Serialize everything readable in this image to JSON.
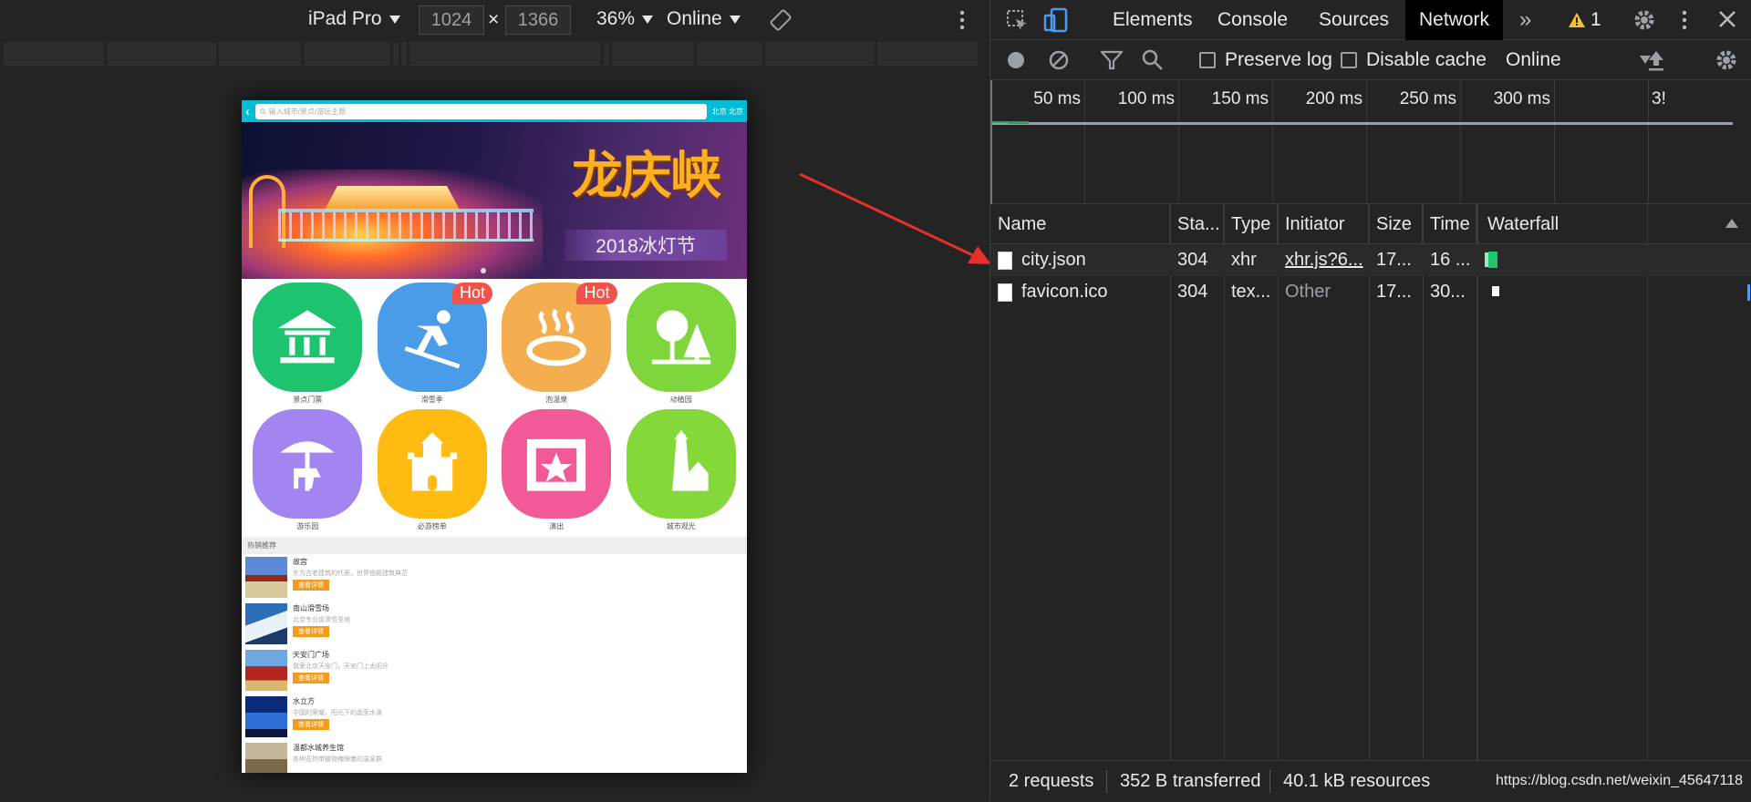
{
  "device_toolbar": {
    "device": "iPad Pro",
    "width": "1024",
    "times": "×",
    "height": "1366",
    "zoom": "36%",
    "throttle": "Online"
  },
  "mobile_page": {
    "search_placeholder": "输入城市/景点/游玩主题",
    "city": "北京 北京",
    "banner_title": "龙庆峡",
    "banner_subtitle": "2018冰灯节",
    "categories": [
      {
        "label": "景点门票",
        "icon": "pavilion-icon",
        "color": "#1ec36f",
        "hot": ""
      },
      {
        "label": "滑雪季",
        "icon": "skier-icon",
        "color": "#4a9be8",
        "hot": "Hot"
      },
      {
        "label": "泡温泉",
        "icon": "hot-spring-icon",
        "color": "#f4ad4f",
        "hot": "Hot"
      },
      {
        "label": "动植园",
        "icon": "trees-icon",
        "color": "#7fd53c",
        "hot": ""
      },
      {
        "label": "游乐园",
        "icon": "carousel-icon",
        "color": "#a285f0",
        "hot": ""
      },
      {
        "label": "必游榜单",
        "icon": "castle-icon",
        "color": "#ffbb12",
        "hot": ""
      },
      {
        "label": "演出",
        "icon": "stage-icon",
        "color": "#f25a97",
        "hot": ""
      },
      {
        "label": "城市观光",
        "icon": "tower-icon",
        "color": "#84d83a",
        "hot": ""
      }
    ],
    "recommend_title": "热销推荐",
    "recommend_items": [
      {
        "name": "故宫",
        "desc": "东方古老建筑的代表，世界宫殿建筑典范",
        "tag": "查看详情"
      },
      {
        "name": "南山滑雪场",
        "desc": "北京专业级滑雪圣地",
        "tag": "查看详情"
      },
      {
        "name": "天安门广场",
        "desc": "我爱北京天安门，天安门上太阳升",
        "tag": "查看详情"
      },
      {
        "name": "水立方",
        "desc": "中国的荣耀，阳光下的晶莹水滴",
        "tag": "查看详情"
      },
      {
        "name": "温都水城养生馆",
        "desc": "各种亚热带植物掩映着的温泉群",
        "tag": ""
      }
    ]
  },
  "devtools": {
    "tabs": [
      "Elements",
      "Console",
      "Sources",
      "Network"
    ],
    "active_tab": "Network",
    "warning_count": "1",
    "toolbar": {
      "preserve_log": "Preserve log",
      "disable_cache": "Disable cache",
      "throttle": "Online"
    },
    "timeline_ticks": [
      "50 ms",
      "100 ms",
      "150 ms",
      "200 ms",
      "250 ms",
      "300 ms",
      "3!"
    ],
    "columns": [
      "Name",
      "Sta...",
      "Type",
      "Initiator",
      "Size",
      "Time",
      "Waterfall"
    ],
    "rows": [
      {
        "name": "city.json",
        "status": "304",
        "type": "xhr",
        "initiator": "xhr.js?6...",
        "size": "17...",
        "time": "16 ..."
      },
      {
        "name": "favicon.ico",
        "status": "304",
        "type": "tex...",
        "initiator": "Other",
        "size": "17...",
        "time": "30..."
      }
    ],
    "status_bar": {
      "requests": "2 requests",
      "transferred": "352 B transferred",
      "resources": "40.1 kB resources"
    },
    "watermark": "https://blog.csdn.net/weixin_45647118"
  },
  "colors": {
    "accent": "#00bcd4",
    "hot_badge": "#f0534a",
    "tag": "#f39b1a",
    "arrow": "#e8302a"
  }
}
